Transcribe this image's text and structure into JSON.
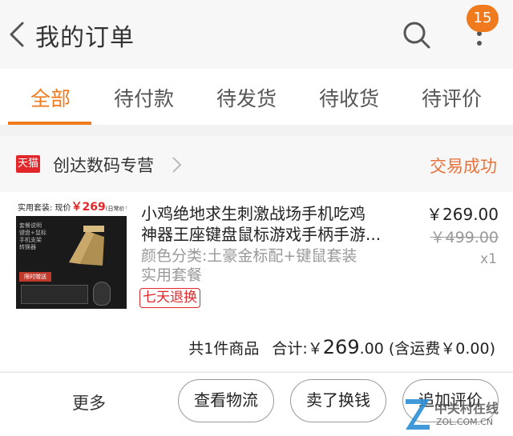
{
  "header": {
    "title": "我的订单",
    "notification_count": "15",
    "icons": {
      "back": "chevron-left-icon",
      "search": "search-icon",
      "more": "more-vertical-icon"
    }
  },
  "tabs": [
    {
      "label": "全部",
      "active": true
    },
    {
      "label": "待付款",
      "active": false
    },
    {
      "label": "待发货",
      "active": false
    },
    {
      "label": "待收货",
      "active": false
    },
    {
      "label": "待评价",
      "active": false
    }
  ],
  "order": {
    "shop_badge": "天猫",
    "shop_name": "创达数码专营",
    "status": "交易成功",
    "item": {
      "name_line1": "小鸡绝地求生刺激战场手机吃鸡",
      "name_line2": "神器王座键盘鼠标游戏手柄手游...",
      "spec_line1": "颜色分类:土豪金标配+键鼠套装",
      "spec_line2": "实用套餐",
      "return_tag": "七天退换",
      "price": "￥269.00",
      "original_price": "￥499.00",
      "quantity": "x1",
      "thumbnail": {
        "label": "实用套装: 现价",
        "price": "￥269",
        "note": "(日常价￥299)",
        "list": "套餐说明\n键盘+鼠标\n手机支架\n转换器",
        "ribbon": "限时赠送"
      }
    },
    "summary": {
      "count_text": "共1件商品",
      "total_label": "合计:",
      "total_symbol": "￥",
      "total_int": "269",
      "total_dec": ".00",
      "shipping_note": "(含运费￥0.00)"
    }
  },
  "actions": {
    "more": "更多",
    "logistics": "查看物流",
    "resell": "卖了换钱",
    "review": "追加评价"
  },
  "watermark": {
    "cn": "中关村在线",
    "en": "ZOL.COM.CN"
  },
  "colors": {
    "accent": "#f07b1e",
    "tmall_red": "#e2272b",
    "status": "#e8733a"
  }
}
